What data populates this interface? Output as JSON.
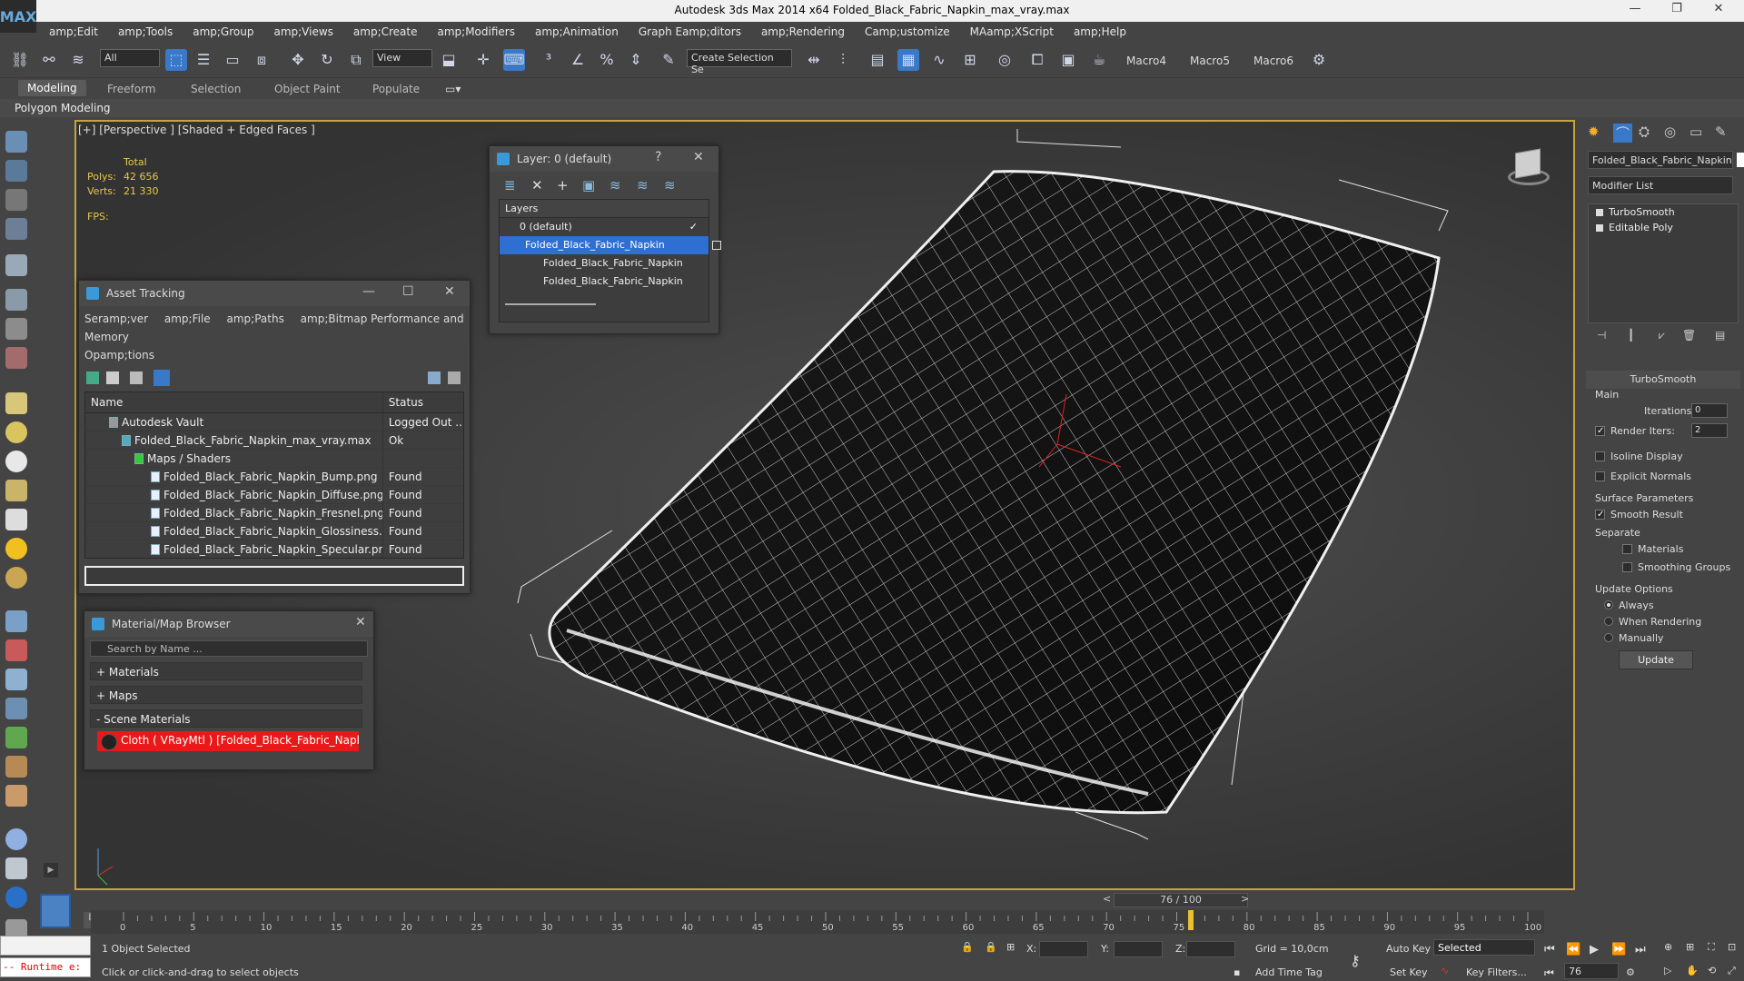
{
  "window": {
    "title": "Autodesk 3ds Max  2014 x64     Folded_Black_Fabric_Napkin_max_vray.max",
    "logo": "MAX"
  },
  "menu": [
    "amp;Edit",
    "amp;Tools",
    "amp;Group",
    "amp;Views",
    "amp;Create",
    "amp;Modifiers",
    "amp;Animation",
    "Graph Eamp;ditors",
    "amp;Rendering",
    "Camp;ustomize",
    "MAamp;XScript",
    "amp;Help"
  ],
  "toolbar": {
    "selection_filter": "All",
    "ref_coord": "View",
    "named_selection": "Create Selection Se",
    "macros": [
      "Macro4",
      "Macro5",
      "Macro6"
    ]
  },
  "ribbon": {
    "tabs": [
      "Modeling",
      "Freeform",
      "Selection",
      "Object Paint",
      "Populate"
    ],
    "active": "Modeling",
    "sub": "Polygon Modeling"
  },
  "viewport": {
    "label": "[+] [Perspective ] [Shaded + Edged Faces ]",
    "stats_total": "Total",
    "polys_label": "Polys:",
    "polys_value": "42 656",
    "verts_label": "Verts:",
    "verts_value": "21 330",
    "fps_label": "FPS:"
  },
  "asset_tracking": {
    "title": "Asset Tracking",
    "menu": [
      "Seramp;ver",
      "amp;File",
      "amp;Paths",
      "amp;Bitmap Performance and Memory",
      "Opamp;tions"
    ],
    "columns": [
      "Name",
      "Status"
    ],
    "rows": [
      {
        "name": "Autodesk Vault",
        "status": "Logged Out ..."
      },
      {
        "name": "Folded_Black_Fabric_Napkin_max_vray.max",
        "status": "Ok"
      },
      {
        "name": "Maps / Shaders",
        "status": ""
      },
      {
        "name": "Folded_Black_Fabric_Napkin_Bump.png",
        "status": "Found"
      },
      {
        "name": "Folded_Black_Fabric_Napkin_Diffuse.png",
        "status": "Found"
      },
      {
        "name": "Folded_Black_Fabric_Napkin_Fresnel.png",
        "status": "Found"
      },
      {
        "name": "Folded_Black_Fabric_Napkin_Glossiness.png",
        "status": "Found"
      },
      {
        "name": "Folded_Black_Fabric_Napkin_Specular.png",
        "status": "Found"
      }
    ]
  },
  "layer": {
    "title": "Layer: 0 (default)",
    "help": "?",
    "header": "Layers",
    "rows": [
      "0 (default)",
      "Folded_Black_Fabric_Napkin",
      "Folded_Black_Fabric_Napkin",
      "Folded_Black_Fabric_Napkin"
    ]
  },
  "material_browser": {
    "title": "Material/Map Browser",
    "search_placeholder": "Search by Name ...",
    "categories": [
      "+ Materials",
      "+ Maps",
      "- Scene Materials"
    ],
    "item": "Cloth ( VRayMtl ) [Folded_Black_Fabric_Napkin]"
  },
  "command_panel": {
    "object_name": "Folded_Black_Fabric_Napkin",
    "modifier_list": "Modifier List",
    "stack": [
      "TurboSmooth",
      "Editable Poly"
    ],
    "rollout_title": "TurboSmooth",
    "main_label": "Main",
    "iterations_label": "Iterations:",
    "iterations_value": "0",
    "render_iters_label": "Render Iters:",
    "render_iters_value": "2",
    "isoline": "Isoline Display",
    "explicit_normals": "Explicit Normals",
    "surface_params": "Surface Parameters",
    "smooth_result": "Smooth Result",
    "separate": "Separate",
    "materials": "Materials",
    "smoothing_groups": "Smoothing Groups",
    "update_options": "Update Options",
    "always": "Always",
    "when_rendering": "When Rendering",
    "manually": "Manually",
    "update_button": "Update"
  },
  "timeline": {
    "slider": "76 / 100",
    "ticks": [
      "0",
      "5",
      "10",
      "15",
      "20",
      "25",
      "30",
      "35",
      "40",
      "45",
      "50",
      "55",
      "60",
      "65",
      "70",
      "75",
      "80",
      "85",
      "90",
      "95",
      "100"
    ],
    "current_frame": 76
  },
  "status": {
    "runtime": "-- Runtime e:",
    "selected": "1 Object Selected",
    "hint": "Click or click-and-drag to select objects",
    "x_label": "X:",
    "y_label": "Y:",
    "z_label": "Z:",
    "grid": "Grid = 10,0cm",
    "add_time_tag": "Add Time Tag",
    "auto_key": "Auto Key",
    "set_key": "Set Key",
    "selected_dropdown": "Selected",
    "key_filters": "Key Filters...",
    "frame_value": "76"
  }
}
